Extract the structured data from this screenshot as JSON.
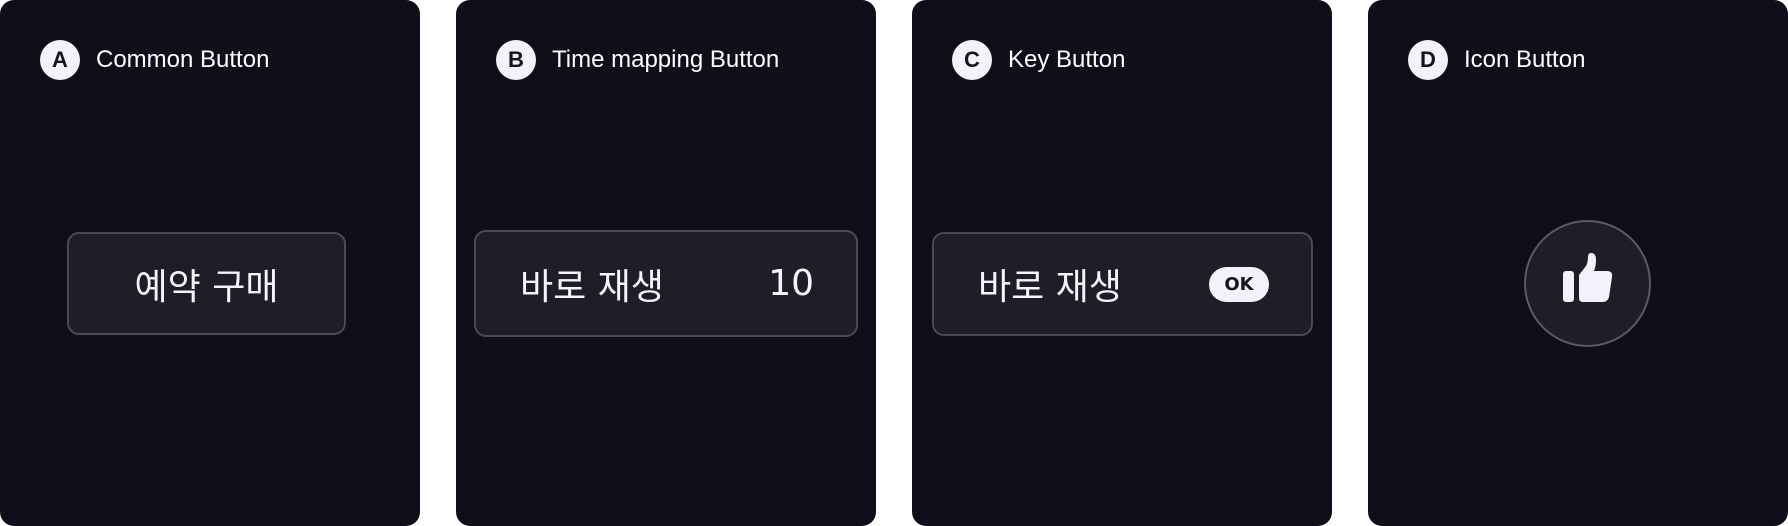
{
  "panels": [
    {
      "badge": "A",
      "title": "Common Button",
      "button_label": "예약 구매"
    },
    {
      "badge": "B",
      "title": "Time mapping Button",
      "button_label": "바로 재생",
      "button_value": "10"
    },
    {
      "badge": "C",
      "title": "Key Button",
      "button_label": "바로 재생",
      "key_label": "OK"
    },
    {
      "badge": "D",
      "title": "Icon Button",
      "icon": "thumbs-up-icon"
    }
  ],
  "colors": {
    "panel_background": "#0f0e1b",
    "button_background": "#1e1e29",
    "button_border": "#4a4a54",
    "badge_background": "#f2f2fb",
    "text": "#ffffff"
  }
}
